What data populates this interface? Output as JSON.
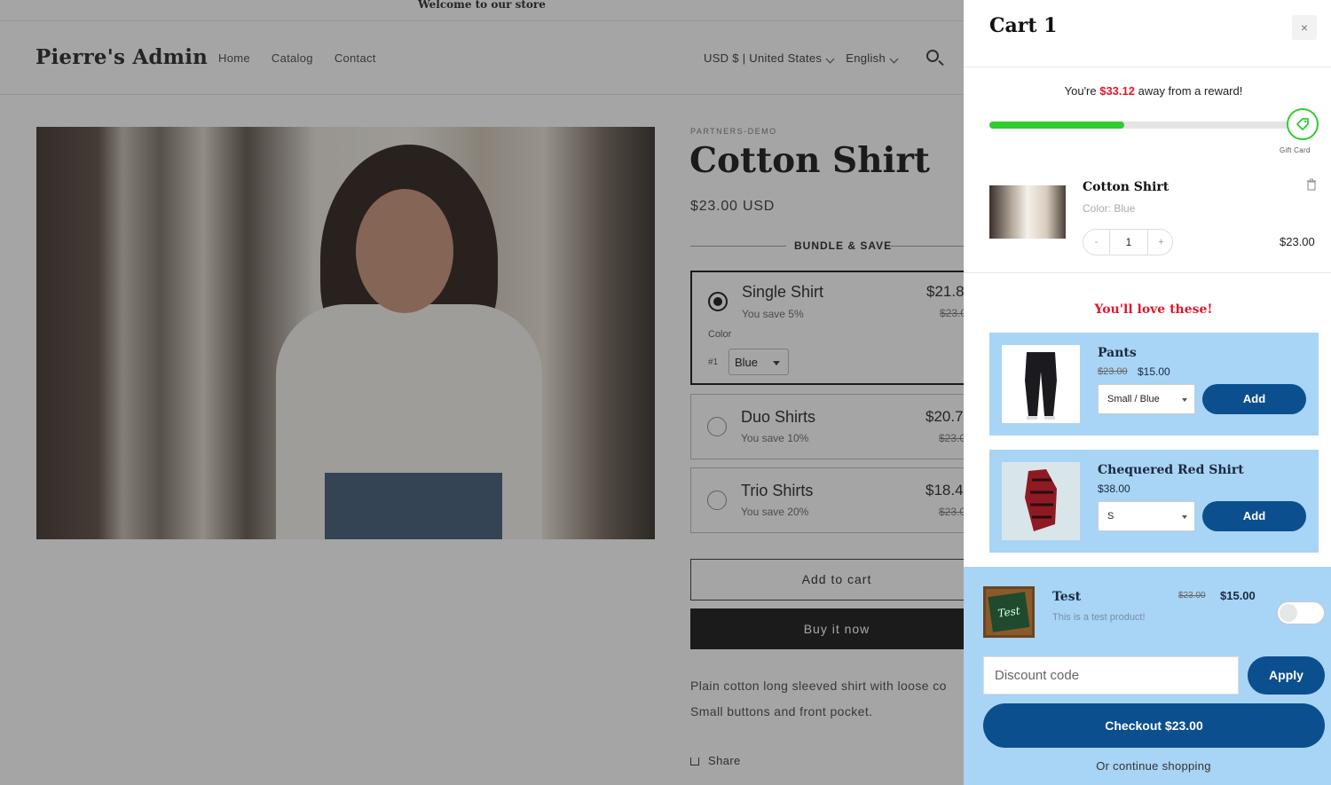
{
  "store": {
    "announcement": "Welcome to our store",
    "logo": "Pierre's Admin",
    "nav": [
      "Home",
      "Catalog",
      "Contact"
    ],
    "currency": "USD $ | United States",
    "language": "English",
    "product": {
      "vendor": "PARTNERS-DEMO",
      "title": "Cotton Shirt",
      "price": "$23.00 USD",
      "bundle_heading": "BUNDLE & SAVE",
      "options": [
        {
          "name": "Single Shirt",
          "save": "You save 5%",
          "price": "$21.8",
          "was": "$23.0",
          "selected": true
        },
        {
          "name": "Duo Shirts",
          "save": "You save 10%",
          "price": "$20.7",
          "was": "$23.0",
          "selected": false
        },
        {
          "name": "Trio Shirts",
          "save": "You save 20%",
          "price": "$18.4",
          "was": "$23.0",
          "selected": false
        }
      ],
      "color_label": "Color",
      "item_number": "#1",
      "color_value": "Blue",
      "add_to_cart": "Add to cart",
      "buy_now": "Buy it now",
      "description_lines": [
        "Plain cotton long sleeved shirt with loose co",
        "Small buttons and front pocket."
      ],
      "share": "Share"
    }
  },
  "cart": {
    "title": "Cart 1",
    "close": "×",
    "reward_prefix": "You're ",
    "reward_amount": "$33.12",
    "reward_suffix": " away from a reward!",
    "reward_progress": 0.44,
    "reward_label": "Gift Card",
    "item": {
      "name": "Cotton Shirt",
      "variant": "Color: Blue",
      "quantity": "1",
      "minus": "-",
      "plus": "+",
      "price": "$23.00"
    },
    "upsell_heading": "You'll love these!",
    "upsells": [
      {
        "name": "Pants",
        "old_price": "$23.00",
        "price": "$15.00",
        "variant": "Small / Blue",
        "add": "Add"
      },
      {
        "name": "Chequered Red Shirt",
        "price": "$38.00",
        "variant": "S",
        "add": "Add"
      }
    ],
    "addon": {
      "name": "Test",
      "description": "This is a test product!",
      "old_price": "$23.00",
      "price": "$15.00",
      "thumb_text": "Test"
    },
    "discount_placeholder": "Discount code",
    "apply": "Apply",
    "checkout": "Checkout $23.00",
    "continue": "Or continue shopping"
  },
  "colors": {
    "accent": "#0b4f8f",
    "reward_red": "#e0172b",
    "progress_green": "#2ecc2e",
    "panel_blue": "#a8d4f5"
  }
}
